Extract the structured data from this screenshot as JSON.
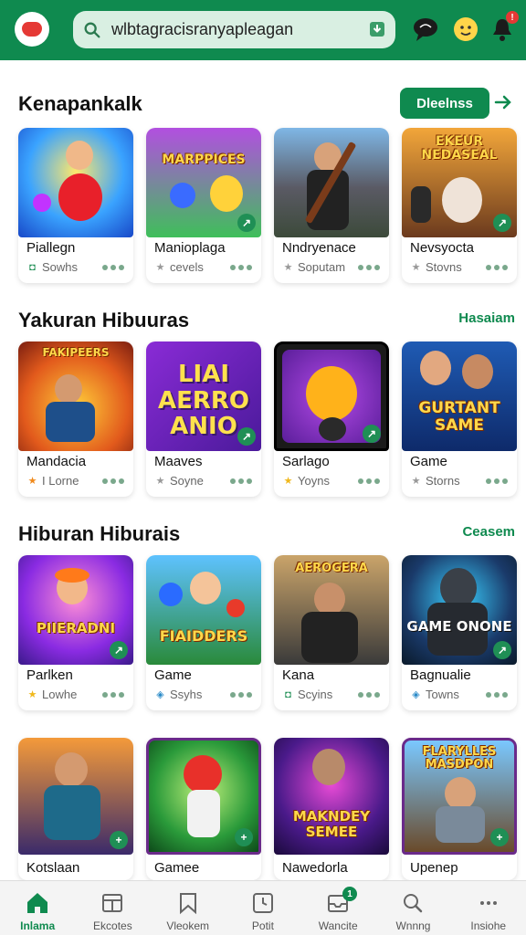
{
  "header": {
    "search_value": "wlbtagracisranyapleagan",
    "icons": [
      "app-logo-icon",
      "search-icon",
      "download-icon",
      "chat-icon",
      "smile-icon",
      "bell-icon"
    ],
    "notification_badge": "!"
  },
  "sections": [
    {
      "title": "Kenapankalk",
      "action_label": "Dleelnss",
      "cards": [
        {
          "name": "Piallegn",
          "meta": "Sowhs",
          "meta_icon": "app-icon",
          "thumb_text": ""
        },
        {
          "name": "Manioplaga",
          "meta": "cevels",
          "meta_icon": "star-icon",
          "thumb_text": "MARPPICES"
        },
        {
          "name": "Nndryenace",
          "meta": "Soputam",
          "meta_icon": "star-icon",
          "thumb_text": ""
        },
        {
          "name": "Nevsyocta",
          "meta": "Stovns",
          "meta_icon": "star-icon",
          "thumb_text": "EKEUR NEDASEAL"
        }
      ]
    },
    {
      "title": "Yakuran Hibuuras",
      "action_label": "Hasaiam",
      "cards": [
        {
          "name": "Mandacia",
          "meta": "I Lorne",
          "meta_icon": "star-icon",
          "thumb_text": "FAKIPEERS"
        },
        {
          "name": "Maaves",
          "meta": "Soyne",
          "meta_icon": "star-icon",
          "thumb_text": "LIAI AERRO ANIO"
        },
        {
          "name": "Sarlago",
          "meta": "Yoyns",
          "meta_icon": "star-icon",
          "thumb_text": ""
        },
        {
          "name": "Game",
          "meta": "Storns",
          "meta_icon": "star-icon",
          "thumb_text": "GURTANT SAME"
        }
      ]
    },
    {
      "title": "Hiburan Hiburais",
      "action_label": "Ceasem",
      "cards": [
        {
          "name": "Parlken",
          "meta": "Lowhe",
          "meta_icon": "star-icon",
          "thumb_text": "PIIERADNI"
        },
        {
          "name": "Game",
          "meta": "Ssyhs",
          "meta_icon": "app-icon",
          "thumb_text": "FIAIDDERS"
        },
        {
          "name": "Kana",
          "meta": "Scyins",
          "meta_icon": "app-icon",
          "thumb_text": "AEROGERA"
        },
        {
          "name": "Bagnualie",
          "meta": "Towns",
          "meta_icon": "app-icon",
          "thumb_text": "GAME ONONE"
        }
      ]
    },
    {
      "title": "",
      "action_label": "",
      "cards": [
        {
          "name": "Kotslaan",
          "meta": "",
          "meta_icon": "",
          "thumb_text": ""
        },
        {
          "name": "Gamee",
          "meta": "",
          "meta_icon": "",
          "thumb_text": ""
        },
        {
          "name": "Nawedorla",
          "meta": "",
          "meta_icon": "",
          "thumb_text": "MAKNDEY SEMEE"
        },
        {
          "name": "Upenep",
          "meta": "",
          "meta_icon": "",
          "thumb_text": "FLARYLLES MASDPON"
        }
      ]
    }
  ],
  "bottom_nav": [
    {
      "label": "Inlama",
      "icon": "home-icon",
      "active": true
    },
    {
      "label": "Ekcotes",
      "icon": "calendar-icon",
      "active": false
    },
    {
      "label": "Vleokem",
      "icon": "bookmark-icon",
      "active": false
    },
    {
      "label": "Potit",
      "icon": "clock-icon",
      "active": false
    },
    {
      "label": "Wancite",
      "icon": "inbox-icon",
      "active": false,
      "badge": "1"
    },
    {
      "label": "Wnnng",
      "icon": "search-icon",
      "active": false
    },
    {
      "label": "Insiohe",
      "icon": "more-icon",
      "active": false
    }
  ],
  "colors": {
    "brand": "#0f8a4f",
    "badge_red": "#e53935"
  }
}
